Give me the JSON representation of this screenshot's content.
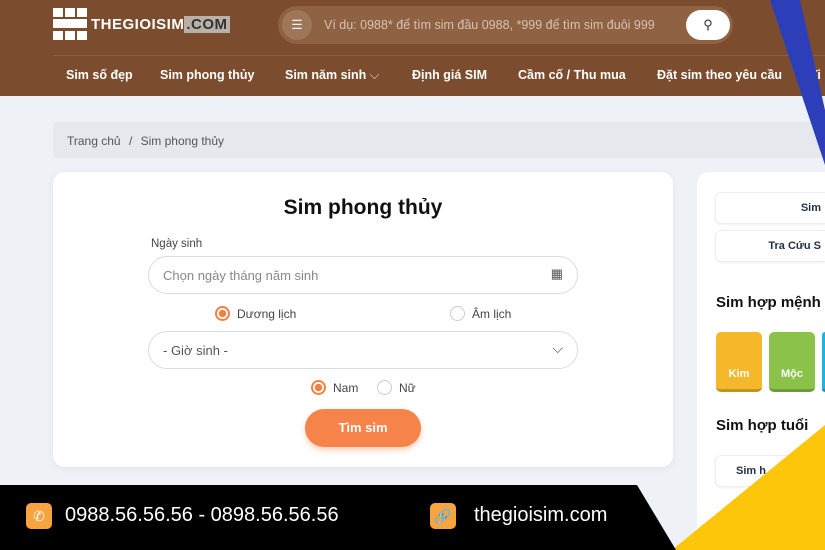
{
  "header": {
    "logo_main": "THEGIOISIM",
    "logo_suffix": ".COM",
    "search_placeholder": "Ví dụ: 0988* để tìm sim đầu 0988, *999 để tìm sim đuôi 999",
    "nav": [
      "Sim số đẹp",
      "Sim phong thủy",
      "Sim năm sinh",
      "Định giá SIM",
      "Cầm cố / Thu mua",
      "Đặt sim theo yêu cầu",
      "Ti"
    ]
  },
  "breadcrumb": {
    "home": "Trang chủ",
    "separator": "/",
    "current": "Sim phong thủy"
  },
  "form": {
    "title": "Sim phong thủy",
    "dob_label": "Ngày sinh",
    "dob_placeholder": "Chọn ngày tháng năm sinh",
    "calendar_type": [
      {
        "label": "Dương lịch",
        "selected": true
      },
      {
        "label": "Âm lịch",
        "selected": false
      }
    ],
    "hour_select": "- Giờ sinh -",
    "gender": [
      {
        "label": "Nam",
        "selected": true
      },
      {
        "label": "Nữ",
        "selected": false
      }
    ],
    "submit": "Tìm sim"
  },
  "sidebar": {
    "buttons": [
      "Sim",
      "Tra Cứu S"
    ],
    "menh_title": "Sim hợp mệnh",
    "elements": [
      {
        "label": "Kim",
        "color": "#f4b82a"
      },
      {
        "label": "Mộc",
        "color": "#8bc34a"
      },
      {
        "label": "",
        "color": "#1bb3e6"
      }
    ],
    "tuoi_title": "Sim hợp tuổi",
    "tuoi_items": [
      "Sim h"
    ]
  },
  "footer": {
    "phones": "0988.56.56.56 - 0898.56.56.56",
    "website": "thegioisim.com"
  },
  "colors": {
    "header": "#7b4d2e",
    "accent": "#f5834a",
    "footer": "#000000",
    "stripe_blue": "#2c3fb8",
    "stripe_yellow": "#fdc60a"
  }
}
